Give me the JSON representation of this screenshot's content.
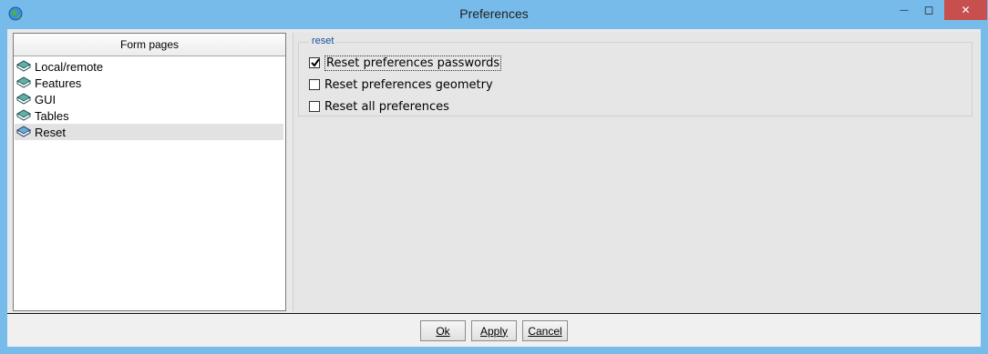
{
  "window": {
    "title": "Preferences",
    "minimize_glyph": "—",
    "maximize_glyph": "◻",
    "close_glyph": "✕"
  },
  "left_panel": {
    "header": "Form pages",
    "items": [
      {
        "label": "Local/remote",
        "selected": false,
        "icon": "book-icon"
      },
      {
        "label": "Features",
        "selected": false,
        "icon": "book-icon"
      },
      {
        "label": "GUI",
        "selected": false,
        "icon": "book-icon"
      },
      {
        "label": "Tables",
        "selected": false,
        "icon": "book-icon"
      },
      {
        "label": "Reset",
        "selected": true,
        "icon": "book-icon"
      }
    ]
  },
  "reset_group": {
    "title": "reset",
    "options": [
      {
        "label": "Reset preferences passwords",
        "checked": true
      },
      {
        "label": "Reset preferences geometry",
        "checked": false
      },
      {
        "label": "Reset all preferences",
        "checked": false
      }
    ]
  },
  "buttons": {
    "ok": "Ok",
    "apply": "Apply",
    "cancel": "Cancel"
  },
  "colors": {
    "title_bar": "#77bbeb",
    "close_button": "#c7504e",
    "group_title": "#1a4fa0",
    "selected_item": "#e2e2e2"
  }
}
